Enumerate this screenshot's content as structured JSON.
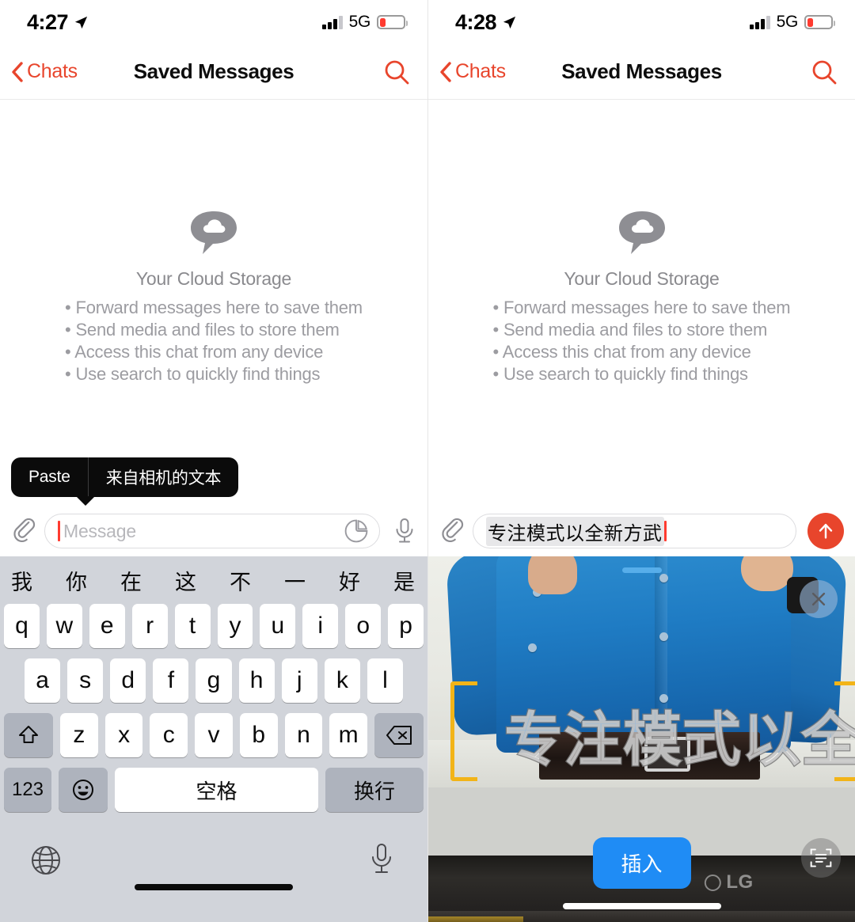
{
  "left": {
    "status": {
      "time": "4:27",
      "network": "5G",
      "location_icon": "location-arrow-icon"
    },
    "nav": {
      "back": "Chats",
      "title": "Saved Messages",
      "search_icon": "search-icon"
    },
    "empty": {
      "icon": "cloud-chat-icon",
      "title": "Your Cloud Storage",
      "bullets": [
        "• Forward messages here to save them",
        "• Send media and files to store them",
        "• Access this chat from any device",
        "• Use search to quickly find things"
      ]
    },
    "paste_tooltip": {
      "paste": "Paste",
      "text_from_camera": "来自相机的文本"
    },
    "composer": {
      "attach_icon": "paperclip-icon",
      "placeholder": "Message",
      "value": "",
      "sticker_icon": "sticker-icon",
      "mic_icon": "microphone-icon"
    },
    "keyboard": {
      "candidates": [
        "我",
        "你",
        "在",
        "这",
        "不",
        "一",
        "好",
        "是"
      ],
      "candidate_partial": "我",
      "expand_icon": "chevron-down-icon",
      "row1": [
        "q",
        "w",
        "e",
        "r",
        "t",
        "y",
        "u",
        "i",
        "o",
        "p"
      ],
      "row2": [
        "a",
        "s",
        "d",
        "f",
        "g",
        "h",
        "j",
        "k",
        "l"
      ],
      "row3": [
        "z",
        "x",
        "c",
        "v",
        "b",
        "n",
        "m"
      ],
      "shift_icon": "shift-icon",
      "backspace_icon": "backspace-icon",
      "numeric": "123",
      "emoji_icon": "emoji-icon",
      "space": "空格",
      "return": "换行",
      "globe_icon": "globe-icon",
      "dictation_icon": "microphone-icon"
    }
  },
  "right": {
    "status": {
      "time": "4:28",
      "network": "5G",
      "location_icon": "location-arrow-icon",
      "recording_indicator": "green-dot"
    },
    "nav": {
      "back": "Chats",
      "title": "Saved Messages",
      "search_icon": "search-icon"
    },
    "empty": {
      "icon": "cloud-chat-icon",
      "title": "Your Cloud Storage",
      "bullets": [
        "• Forward messages here to save them",
        "• Send media and files to store them",
        "• Access this chat from any device",
        "• Use search to quickly find things"
      ]
    },
    "composer": {
      "attach_icon": "paperclip-icon",
      "value": "专注模式以全新方武",
      "send_icon": "send-arrow-up-icon"
    },
    "camera": {
      "drag_handle": "drag-handle",
      "close_icon": "close-icon",
      "detected_text": "专注模式以全新方式",
      "insert_button": "插入",
      "scan_icon": "live-text-scan-icon",
      "monitor_brand": "LG"
    }
  },
  "colors": {
    "accent_red": "#e8452c",
    "send_red": "#e8452c",
    "insert_blue": "#1f8cf5",
    "handle_blue": "#57aeea",
    "bracket_yellow": "#f2b418",
    "keyboard_bg": "#d1d4da",
    "key_bg": "#ffffff",
    "key_dark": "#aeb3bd",
    "muted_text": "#9c9ca1",
    "battery_red": "#ff3b30",
    "recording_green": "#30d158"
  }
}
